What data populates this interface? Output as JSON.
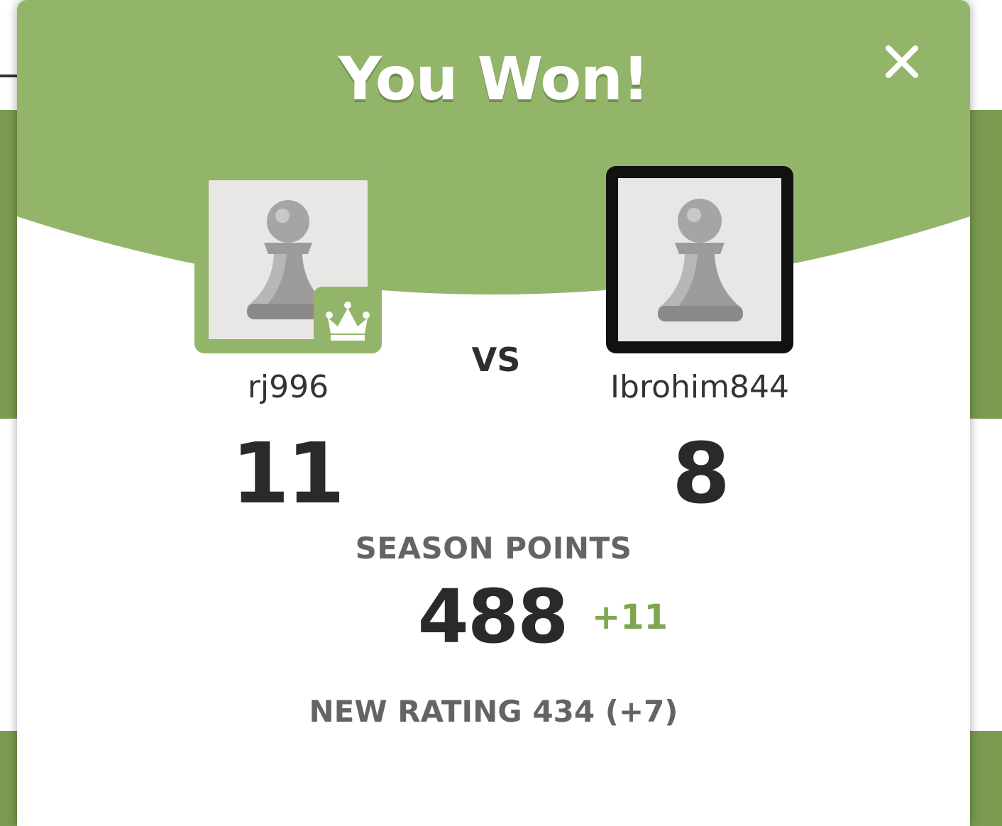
{
  "modal": {
    "title": "You Won!",
    "close_icon": "close-icon"
  },
  "players": {
    "left": {
      "username": "rj996",
      "score": "11",
      "avatar_icon": "pawn-icon",
      "badge_icon": "crown-icon",
      "winner": true
    },
    "vs_label": "VS",
    "right": {
      "username": "Ibrohim844",
      "score": "8",
      "avatar_icon": "pawn-icon"
    }
  },
  "season": {
    "label": "SEASON POINTS",
    "points": "488",
    "delta": "+11"
  },
  "rating": {
    "text": "NEW RATING 434 (+7)"
  },
  "colors": {
    "header_green": "#93b56a",
    "delta_green": "#7fa650",
    "board_green": "#7a9b50",
    "text_dark": "#2b2a28",
    "text_gray": "#666463"
  }
}
